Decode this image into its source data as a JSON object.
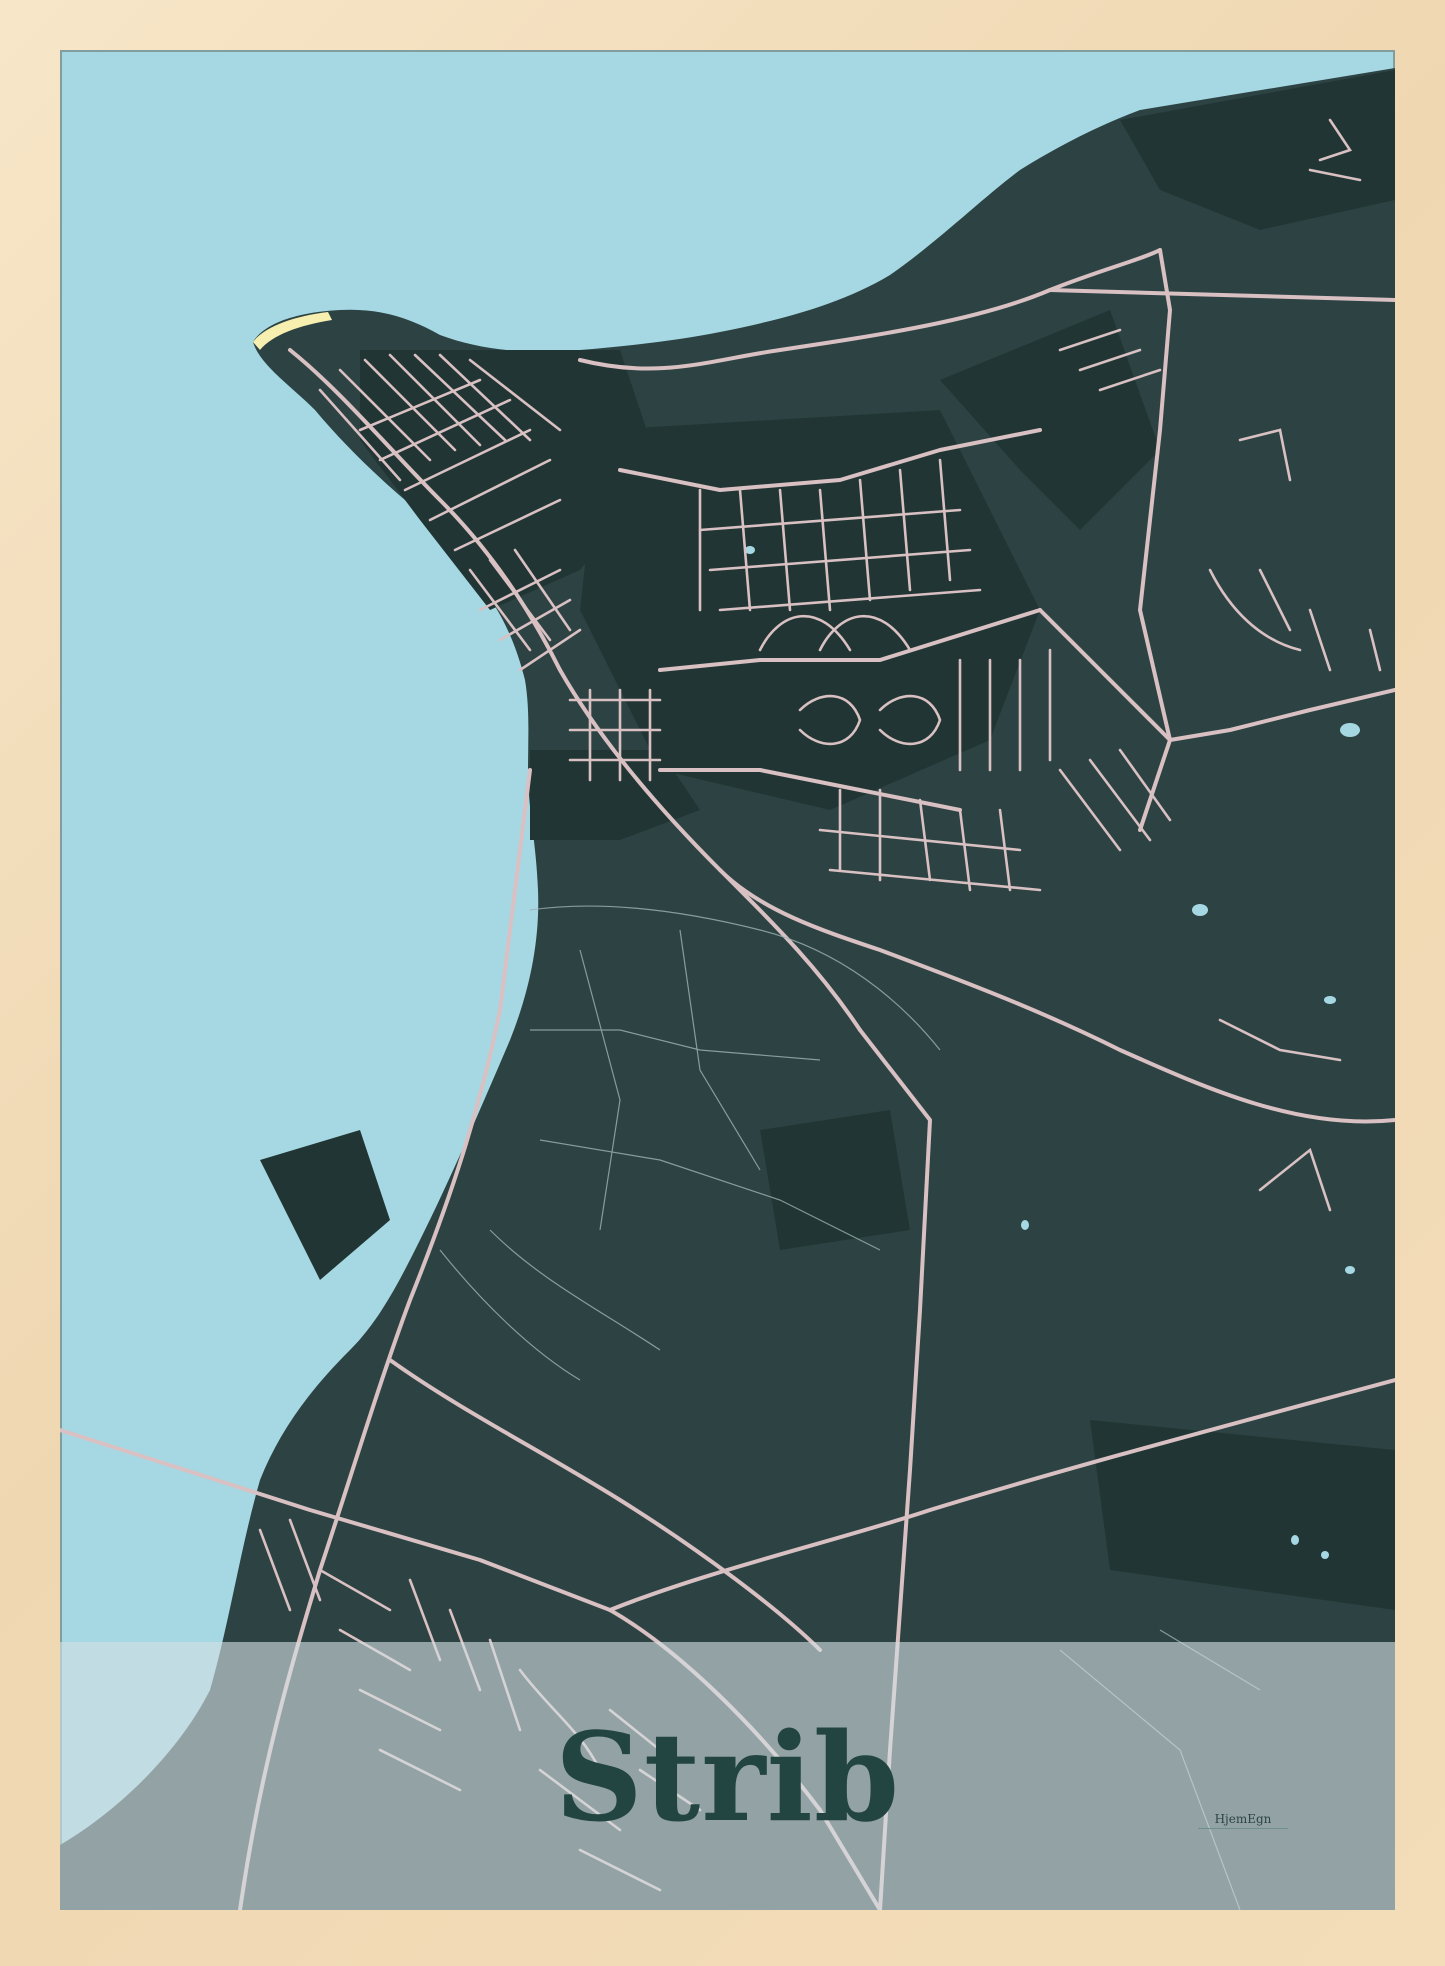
{
  "poster": {
    "title": "Strib",
    "brand": "HjemEgn"
  },
  "colors": {
    "frame": "#f3ddb9",
    "water": "#a6d8e4",
    "land": "#2d4343",
    "land_dark": "#213634",
    "road": "#d9c0c2",
    "beach": "#f6efb0",
    "title_text": "#234542",
    "title_band": "rgba(210,222,226,0.62)"
  }
}
